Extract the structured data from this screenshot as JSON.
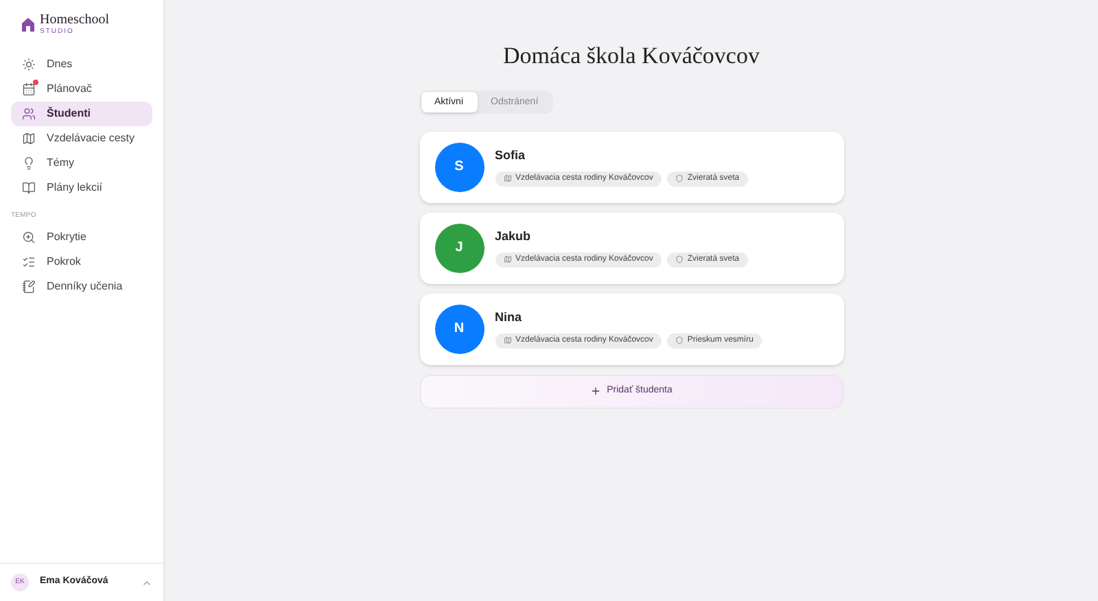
{
  "logo": {
    "name": "Homeschool",
    "sub": "STUDIO"
  },
  "nav": [
    {
      "kind": "sun",
      "label": "Dnes",
      "selected": false,
      "notification": false
    },
    {
      "kind": "calendar",
      "label": "Plánovač",
      "selected": false,
      "notification": true
    },
    {
      "kind": "users",
      "label": "Študenti",
      "selected": true,
      "notification": false
    },
    {
      "kind": "map",
      "label": "Vzdelávacie cesty",
      "selected": false,
      "notification": false
    },
    {
      "kind": "bulb",
      "label": "Témy",
      "selected": false,
      "notification": false
    },
    {
      "kind": "book",
      "label": "Plány lekcií",
      "selected": false,
      "notification": false
    }
  ],
  "section": "TEMPO",
  "nav2": [
    {
      "kind": "zoom",
      "label": "Pokrytie",
      "selected": false,
      "notification": false
    },
    {
      "kind": "list",
      "label": "Pokrok",
      "selected": false,
      "notification": false
    },
    {
      "kind": "notebook",
      "label": "Denníky učenia",
      "selected": false,
      "notification": false
    }
  ],
  "user": {
    "initials": "EK",
    "name": "Ema Kováčová"
  },
  "title": "Domáca škola Kováčovcov",
  "tabs": [
    {
      "label": "Aktívni",
      "selected": true
    },
    {
      "label": "Odstránení",
      "selected": false
    }
  ],
  "students": [
    {
      "initial": "S",
      "name": "Sofia",
      "color": "#0a7cff",
      "tags": [
        {
          "kind": "path",
          "label": "Vzdelávacia cesta rodiny Kováčovcov"
        },
        {
          "kind": "theme",
          "label": "Zvieratá sveta"
        }
      ]
    },
    {
      "initial": "J",
      "name": "Jakub",
      "color": "#2ea043",
      "tags": [
        {
          "kind": "path",
          "label": "Vzdelávacia cesta rodiny Kováčovcov"
        },
        {
          "kind": "theme",
          "label": "Zvieratá sveta"
        }
      ]
    },
    {
      "initial": "N",
      "name": "Nina",
      "color": "#0a7cff",
      "tags": [
        {
          "kind": "path",
          "label": "Vzdelávacia cesta rodiny Kováčovcov"
        },
        {
          "kind": "theme",
          "label": "Prieskum vesmíru"
        }
      ]
    }
  ],
  "add_button": "Pridať študenta"
}
